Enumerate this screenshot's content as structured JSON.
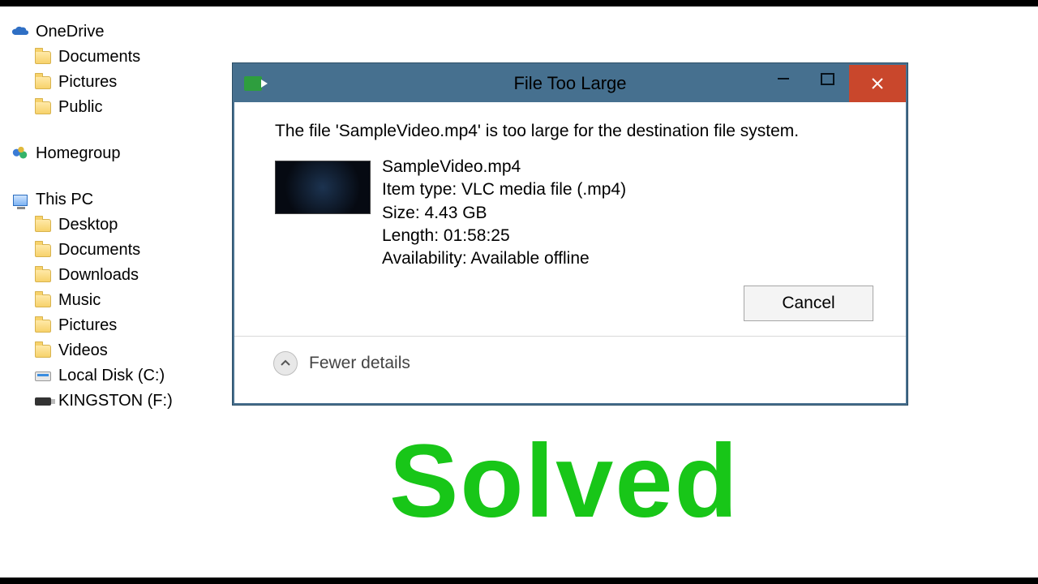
{
  "sidebar": {
    "onedrive": {
      "label": "OneDrive",
      "children": [
        {
          "label": "Documents",
          "icon": "folder"
        },
        {
          "label": "Pictures",
          "icon": "folder"
        },
        {
          "label": "Public",
          "icon": "folder"
        }
      ]
    },
    "homegroup": {
      "label": "Homegroup"
    },
    "thispc": {
      "label": "This PC",
      "children": [
        {
          "label": "Desktop",
          "icon": "folder"
        },
        {
          "label": "Documents",
          "icon": "folder"
        },
        {
          "label": "Downloads",
          "icon": "folder"
        },
        {
          "label": "Music",
          "icon": "folder"
        },
        {
          "label": "Pictures",
          "icon": "folder"
        },
        {
          "label": "Videos",
          "icon": "folder"
        },
        {
          "label": "Local Disk (C:)",
          "icon": "drive"
        },
        {
          "label": "KINGSTON (F:)",
          "icon": "usb"
        }
      ]
    }
  },
  "dialog": {
    "title": "File Too Large",
    "message": "The file 'SampleVideo.mp4' is too large for the destination file system.",
    "file": {
      "name": "SampleVideo.mp4",
      "type_line": "Item type: VLC media file (.mp4)",
      "size_line": "Size: 4.43 GB",
      "length_line": "Length: 01:58:25",
      "availability_line": "Availability: Available offline"
    },
    "cancel_label": "Cancel",
    "details_toggle": "Fewer details"
  },
  "overlay": {
    "solved_text": "Solved"
  }
}
